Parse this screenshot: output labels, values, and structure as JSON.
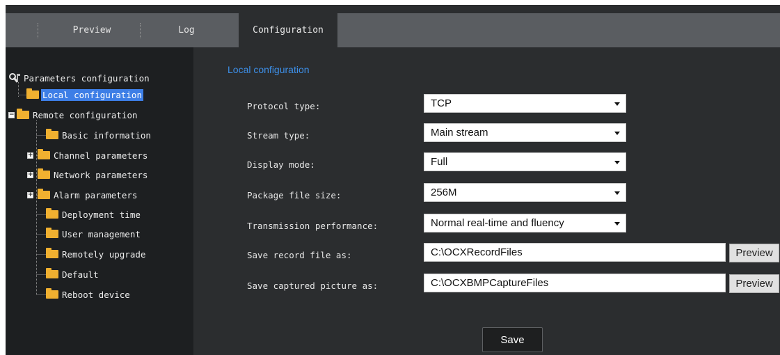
{
  "tabs": [
    {
      "label": "Preview"
    },
    {
      "label": "Log"
    },
    {
      "label": "Configuration",
      "active": true
    }
  ],
  "tree": {
    "root": "Parameters configuration",
    "items": [
      {
        "label": "Local configuration",
        "selected": true
      },
      {
        "label": "Remote configuration",
        "expandable": "minus"
      },
      {
        "label": "Basic information"
      },
      {
        "label": "Channel parameters",
        "expandable": "plus"
      },
      {
        "label": "Network parameters",
        "expandable": "plus"
      },
      {
        "label": "Alarm parameters",
        "expandable": "plus"
      },
      {
        "label": "Deployment time"
      },
      {
        "label": "User management"
      },
      {
        "label": "Remotely upgrade"
      },
      {
        "label": "Default"
      },
      {
        "label": "Reboot device"
      }
    ]
  },
  "form": {
    "title": "Local configuration",
    "protocol": {
      "label": "Protocol type:",
      "value": "TCP"
    },
    "stream": {
      "label": "Stream type:",
      "value": "Main stream"
    },
    "display": {
      "label": "Display mode:",
      "value": "Full"
    },
    "package": {
      "label": "Package file size:",
      "value": "256M"
    },
    "transmission": {
      "label": "Transmission performance:",
      "value": "Normal real-time and fluency"
    },
    "record_path": {
      "label": "Save record file as:",
      "value": "C:\\OCXRecordFiles",
      "button": "Preview"
    },
    "capture_path": {
      "label": "Save captured picture as:",
      "value": "C:\\OCXBMPCaptureFiles",
      "button": "Preview"
    },
    "save_label": "Save"
  },
  "colors": {
    "accent_blue": "#3d8fe8",
    "selected_bg": "#3d7ee6",
    "folder": "#f0b030"
  }
}
